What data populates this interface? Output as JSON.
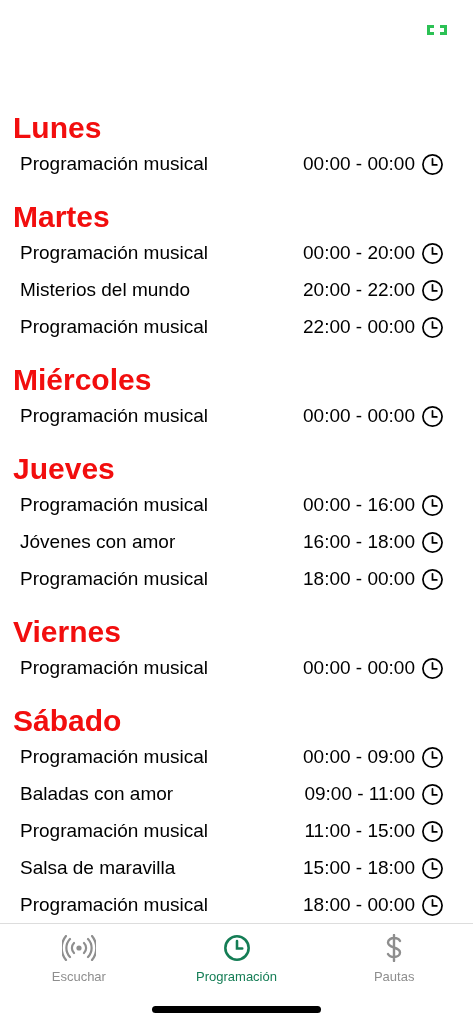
{
  "days": [
    {
      "name": "Lunes",
      "shows": [
        {
          "title": "Programación musical",
          "time": "00:00 - 00:00"
        }
      ]
    },
    {
      "name": "Martes",
      "shows": [
        {
          "title": "Programación musical",
          "time": "00:00 - 20:00"
        },
        {
          "title": "Misterios del mundo",
          "time": "20:00 - 22:00"
        },
        {
          "title": "Programación musical",
          "time": "22:00 - 00:00"
        }
      ]
    },
    {
      "name": "Miércoles",
      "shows": [
        {
          "title": "Programación musical",
          "time": "00:00 - 00:00"
        }
      ]
    },
    {
      "name": "Jueves",
      "shows": [
        {
          "title": "Programación musical",
          "time": "00:00 - 16:00"
        },
        {
          "title": "Jóvenes con amor",
          "time": "16:00 - 18:00"
        },
        {
          "title": "Programación musical",
          "time": "18:00 - 00:00"
        }
      ]
    },
    {
      "name": "Viernes",
      "shows": [
        {
          "title": "Programación musical",
          "time": "00:00 - 00:00"
        }
      ]
    },
    {
      "name": "Sábado",
      "shows": [
        {
          "title": "Programación musical",
          "time": "00:00 - 09:00"
        },
        {
          "title": "Baladas con amor",
          "time": "09:00 - 11:00"
        },
        {
          "title": "Programación musical",
          "time": "11:00 - 15:00"
        },
        {
          "title": "Salsa de maravilla",
          "time": "15:00 - 18:00"
        },
        {
          "title": "Programación musical",
          "time": "18:00 - 00:00"
        }
      ]
    }
  ],
  "tabs": [
    {
      "label": "Escuchar",
      "kind": "listen",
      "selected": false
    },
    {
      "label": "Programación",
      "kind": "schedule",
      "selected": true
    },
    {
      "label": "Pautas",
      "kind": "ads",
      "selected": false
    }
  ]
}
